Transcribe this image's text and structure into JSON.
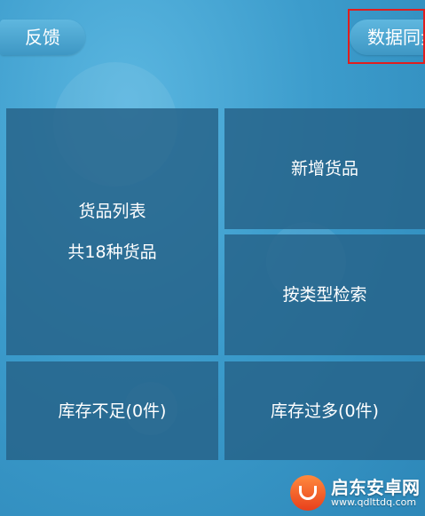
{
  "header": {
    "feedback_label": "反馈",
    "sync_label": "数据同步"
  },
  "tiles": {
    "goods_list": {
      "title": "货品列表",
      "count_text": "共18种货品"
    },
    "add_goods": {
      "label": "新增货品"
    },
    "search_by_type": {
      "label": "按类型检索"
    },
    "low_stock": {
      "label": "库存不足(0件)"
    },
    "over_stock": {
      "label": "库存过多(0件)"
    }
  },
  "watermark": {
    "name": "启东安卓网",
    "url": "www.qdlttdq.com"
  },
  "colors": {
    "background": "#3c9ccc",
    "tile": "#266288",
    "highlight": "#e01e1e",
    "text": "#ffffff"
  }
}
